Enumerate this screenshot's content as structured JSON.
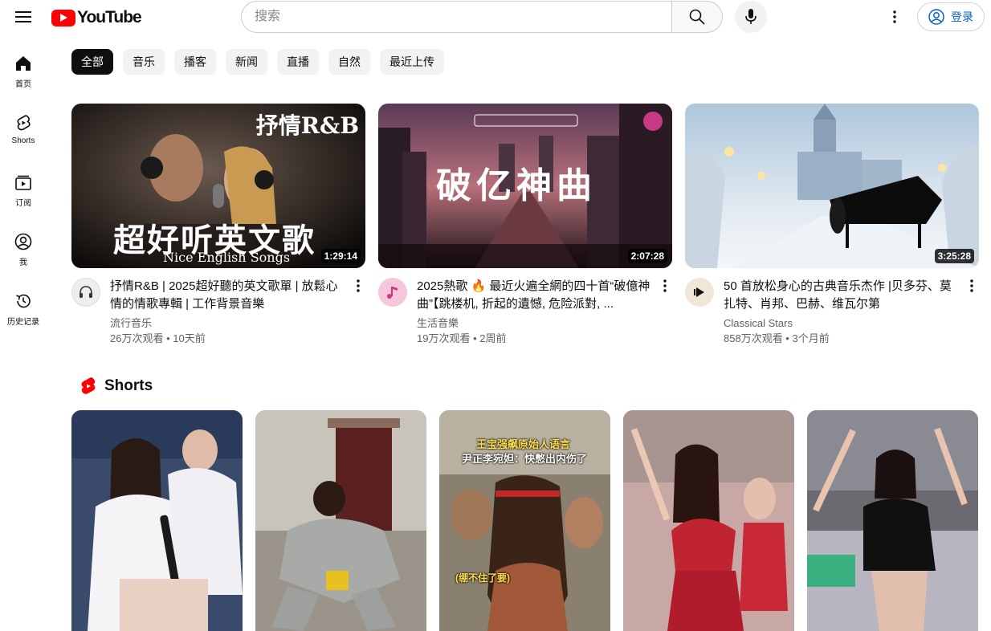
{
  "header": {
    "logo_text": "YouTube",
    "search_placeholder": "搜索",
    "signin_label": "登录"
  },
  "sidebar": {
    "items": [
      {
        "label": "首页",
        "icon": "home-icon"
      },
      {
        "label": "Shorts",
        "icon": "shorts-icon"
      },
      {
        "label": "订阅",
        "icon": "subscriptions-icon"
      },
      {
        "label": "我",
        "icon": "account-icon"
      },
      {
        "label": "历史记录",
        "icon": "history-icon"
      }
    ]
  },
  "chips": [
    "全部",
    "音乐",
    "播客",
    "新闻",
    "直播",
    "自然",
    "最近上传"
  ],
  "videos": [
    {
      "title": "抒情R&B | 2025超好聽的英文歌單 | 放鬆心情的情歌專輯 | 工作背景音樂",
      "channel": "流行音乐",
      "meta": "26万次观看 • 10天前",
      "duration": "1:29:14",
      "thumb_text_top": "抒情R&B",
      "thumb_text_main": "超好听英文歌",
      "thumb_text_sub": "Nice English Songs"
    },
    {
      "title": "2025熱歌 🔥 最近火遍全網的四十首“破億神曲”【跳楼机, 折起的遺憾, 危险派對, ...",
      "channel": "生活音樂",
      "meta": "19万次观看 • 2周前",
      "duration": "2:07:28",
      "thumb_text_main": "破亿神曲"
    },
    {
      "title": "50 首放松身心的古典音乐杰作 |贝多芬、莫扎特、肖邦、巴赫、维瓦尔第",
      "channel": "Classical Stars",
      "meta": "858万次观看 • 3个月前",
      "duration": "3:25:28"
    }
  ],
  "shorts_section": {
    "title": "Shorts",
    "items": [
      {
        "caption_1": "",
        "caption_2": "",
        "caption_3": ""
      },
      {
        "caption_1": "",
        "caption_2": "",
        "caption_3": ""
      },
      {
        "caption_1": "王宝强飙原始人语言",
        "caption_2": "尹正李宛妲：快憋出内伤了",
        "caption_3": "(绷不住了要)"
      },
      {
        "caption_1": "",
        "caption_2": "",
        "caption_3": ""
      },
      {
        "caption_1": "",
        "caption_2": "",
        "caption_3": ""
      }
    ]
  },
  "colors": {
    "brand": "#ff0000",
    "link": "#065fd4",
    "chip_bg": "#f2f2f2",
    "chip_active": "#0f0f0f"
  }
}
